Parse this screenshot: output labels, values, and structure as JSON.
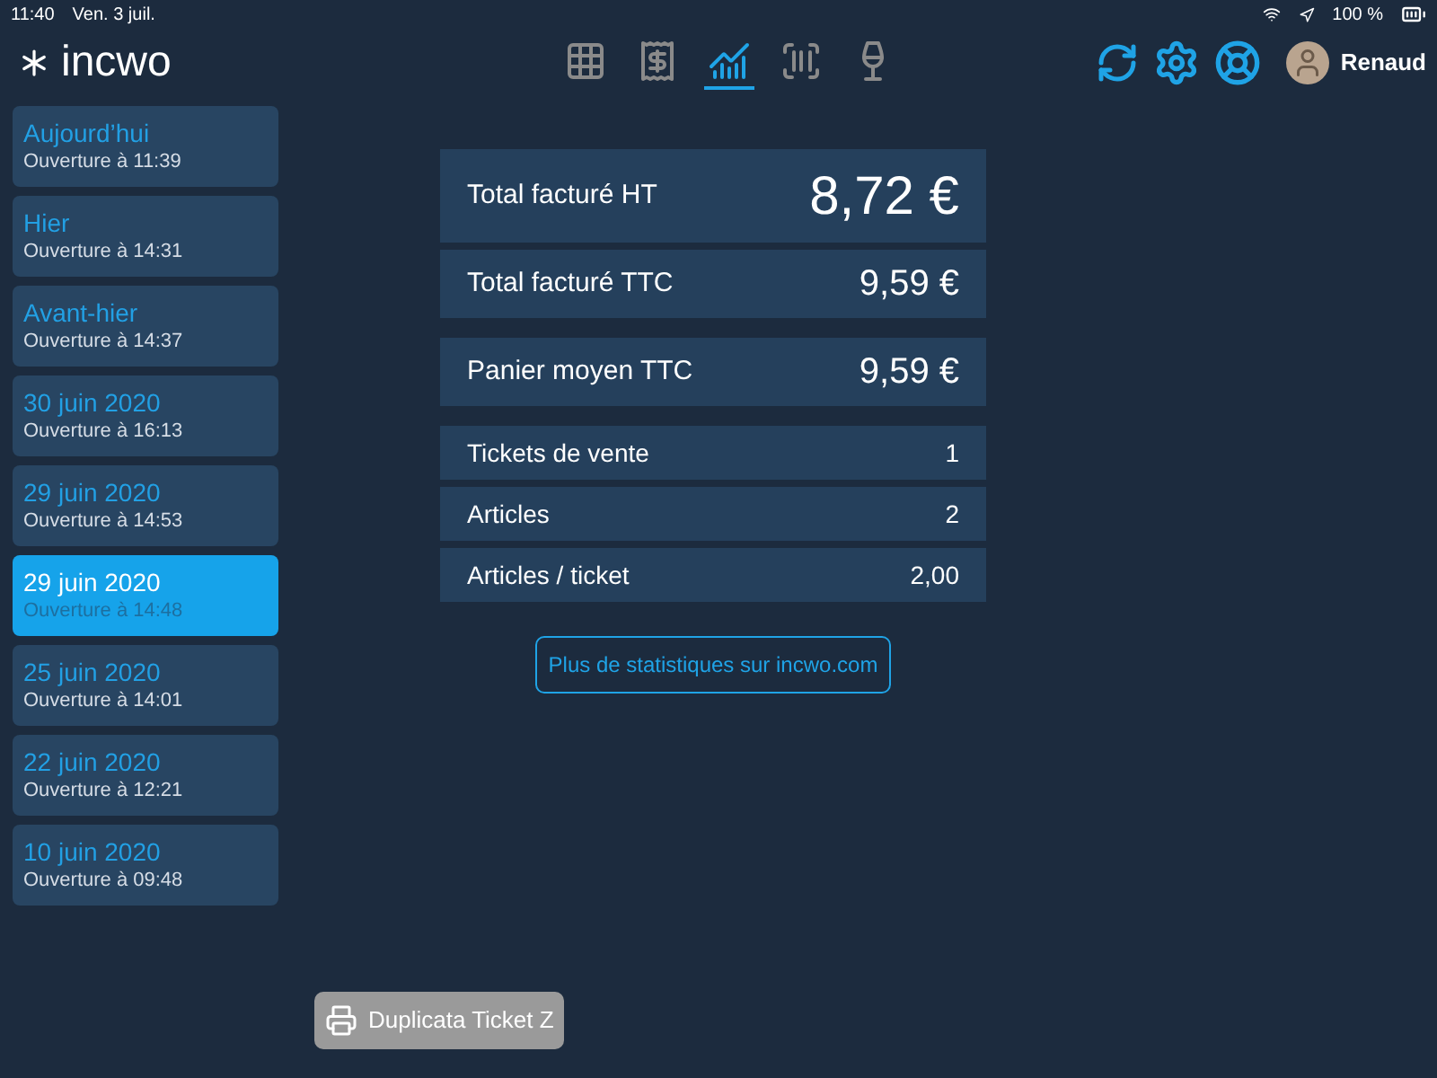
{
  "status_bar": {
    "time": "11:40",
    "date": "Ven. 3 juil.",
    "battery": "100 %"
  },
  "header": {
    "logo": "incwo",
    "nav": [
      {
        "kind": "grid",
        "selected": false
      },
      {
        "kind": "receipt",
        "selected": false
      },
      {
        "kind": "chart",
        "selected": true
      },
      {
        "kind": "barcode",
        "selected": false
      },
      {
        "kind": "dining",
        "selected": false
      }
    ],
    "user": "Renaud"
  },
  "sessions": [
    {
      "title": "Aujourd’hui",
      "subtitle": "Ouverture à 11:39",
      "selected": false
    },
    {
      "title": "Hier",
      "subtitle": "Ouverture à 14:31",
      "selected": false
    },
    {
      "title": "Avant-hier",
      "subtitle": "Ouverture à 14:37",
      "selected": false
    },
    {
      "title": "30 juin 2020",
      "subtitle": "Ouverture à 16:13",
      "selected": false
    },
    {
      "title": "29 juin 2020",
      "subtitle": "Ouverture à 14:53",
      "selected": false
    },
    {
      "title": "29 juin 2020",
      "subtitle": "Ouverture à 14:48",
      "selected": true
    },
    {
      "title": "25 juin 2020",
      "subtitle": "Ouverture à 14:01",
      "selected": false
    },
    {
      "title": "22 juin 2020",
      "subtitle": "Ouverture à 12:21",
      "selected": false
    },
    {
      "title": "10 juin 2020",
      "subtitle": "Ouverture à 09:48",
      "selected": false
    }
  ],
  "stats": [
    [
      {
        "kind": "big",
        "label": "Total facturé HT",
        "value": "8,72 €"
      },
      {
        "kind": "medium",
        "label": "Total facturé TTC",
        "value": "9,59 €"
      }
    ],
    [
      {
        "kind": "medium",
        "label": "Panier moyen TTC",
        "value": "9,59 €"
      }
    ],
    [
      {
        "kind": "small",
        "label": "Tickets de vente",
        "value": "1"
      },
      {
        "kind": "small",
        "label": "Articles",
        "value": "2"
      },
      {
        "kind": "small",
        "label": "Articles / ticket",
        "value": "2,00"
      }
    ]
  ],
  "more_link": "Plus de statistiques sur incwo.com",
  "duplicate_button": "Duplicata Ticket Z"
}
